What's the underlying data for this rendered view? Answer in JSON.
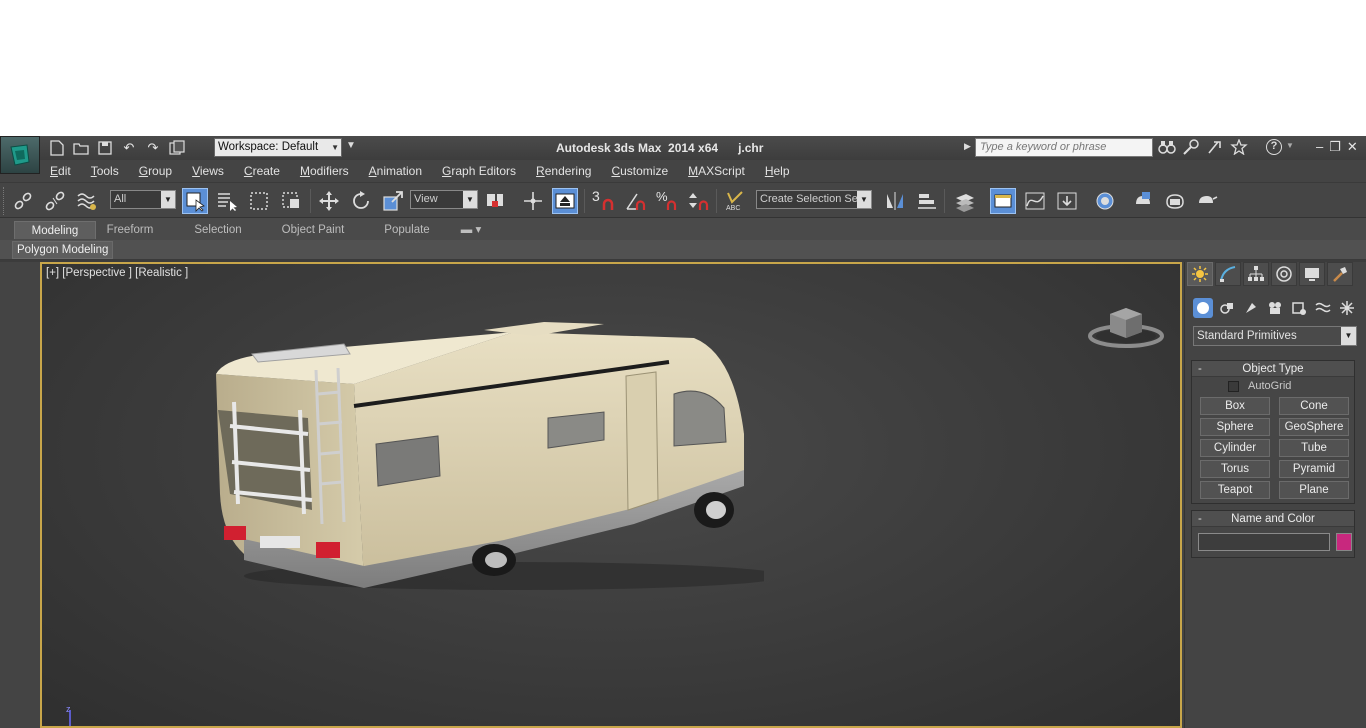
{
  "window": {
    "title": "Autodesk 3ds Max  2014 x64      j.chr",
    "workspace": "Workspace: Default",
    "search_placeholder": "Type a keyword or phrase"
  },
  "menu": [
    "Edit",
    "Tools",
    "Group",
    "Views",
    "Create",
    "Modifiers",
    "Animation",
    "Graph Editors",
    "Rendering",
    "Customize",
    "MAXScript",
    "Help"
  ],
  "toolbar": {
    "selection_filter": "All",
    "reference_coord": "View",
    "snap_label": "3",
    "named_selection": "Create Selection Se"
  },
  "ribbon": {
    "tabs": [
      "Modeling",
      "Freeform",
      "Selection",
      "Object Paint",
      "Populate"
    ],
    "active_tab": "Modeling",
    "subtab": "Polygon Modeling"
  },
  "viewport": {
    "label": "[+] [Perspective ] [Realistic ]",
    "axis": "z"
  },
  "command_panel": {
    "category": "Standard Primitives",
    "object_type": {
      "title": "Object Type",
      "autogrid": "AutoGrid",
      "buttons": [
        "Box",
        "Cone",
        "Sphere",
        "GeoSphere",
        "Cylinder",
        "Tube",
        "Torus",
        "Pyramid",
        "Teapot",
        "Plane"
      ]
    },
    "name_and_color": {
      "title": "Name and Color",
      "color": "#c8287e"
    }
  },
  "colors": {
    "accent": "#5b8fd6",
    "viewport_border": "#c8a64a"
  }
}
